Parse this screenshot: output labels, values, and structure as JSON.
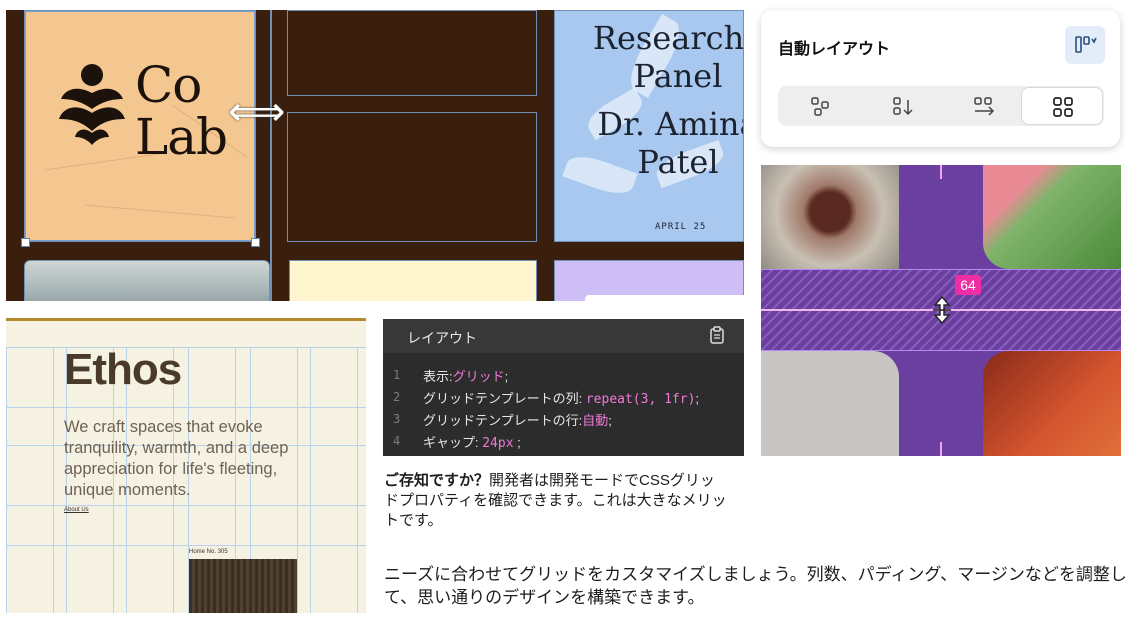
{
  "grid_canvas": {
    "brand_line1": "Co",
    "brand_line2": "Lab",
    "resize_arrow": "⟺",
    "research_title": "Researcher Panel Dr. Amina Patel",
    "research_line1": "Researche",
    "research_line2": "Panel",
    "research_line3": "Dr. Amina",
    "research_line4": "Patel",
    "research_date": "APRIL 25"
  },
  "auto_layout": {
    "title": "自動レイアウト",
    "toggle_icon": "wrap-toggle-icon",
    "options": [
      {
        "icon": "free-layout-icon",
        "active": false
      },
      {
        "icon": "vertical-layout-icon",
        "active": false
      },
      {
        "icon": "horizontal-layout-icon",
        "active": false
      },
      {
        "icon": "grid-layout-icon",
        "active": true
      }
    ]
  },
  "gap_preview": {
    "gap_value": "64",
    "cursor_icon": "resize-vertical-cursor-icon",
    "accent": "#ef2ea6"
  },
  "ethos": {
    "heading": "Ethos",
    "paragraph": "We craft spaces that evoke tranquility, warmth, and a deep appreciation for life's fleeting, unique moments.",
    "link": "About Us",
    "caption": "Home No. 305"
  },
  "code_panel": {
    "title": "レイアウト",
    "copy_icon": "clipboard-icon",
    "lines": [
      {
        "num": "1",
        "prop": "表示:",
        "value": "グリッド",
        "end": ";"
      },
      {
        "num": "2",
        "prop": "グリッドテンプレートの列: ",
        "value": "repeat(3, 1fr)",
        "end": ";"
      },
      {
        "num": "3",
        "prop": "グリッドテンプレートの行:",
        "value": "自動",
        "end": ";"
      },
      {
        "num": "4",
        "prop": "ギャップ: ",
        "value": "24px",
        "end": " ;"
      }
    ]
  },
  "tip": {
    "bold": "ご存知ですか？",
    "text": "開発者は開発モードでCSSグリッドプロパティを確認できます。これは大きなメリットです。"
  },
  "description": "ニーズに合わせてグリッドをカスタマイズしましょう。列数、パディング、マージンなどを調整して、思い通りのデザインを構築できます。"
}
